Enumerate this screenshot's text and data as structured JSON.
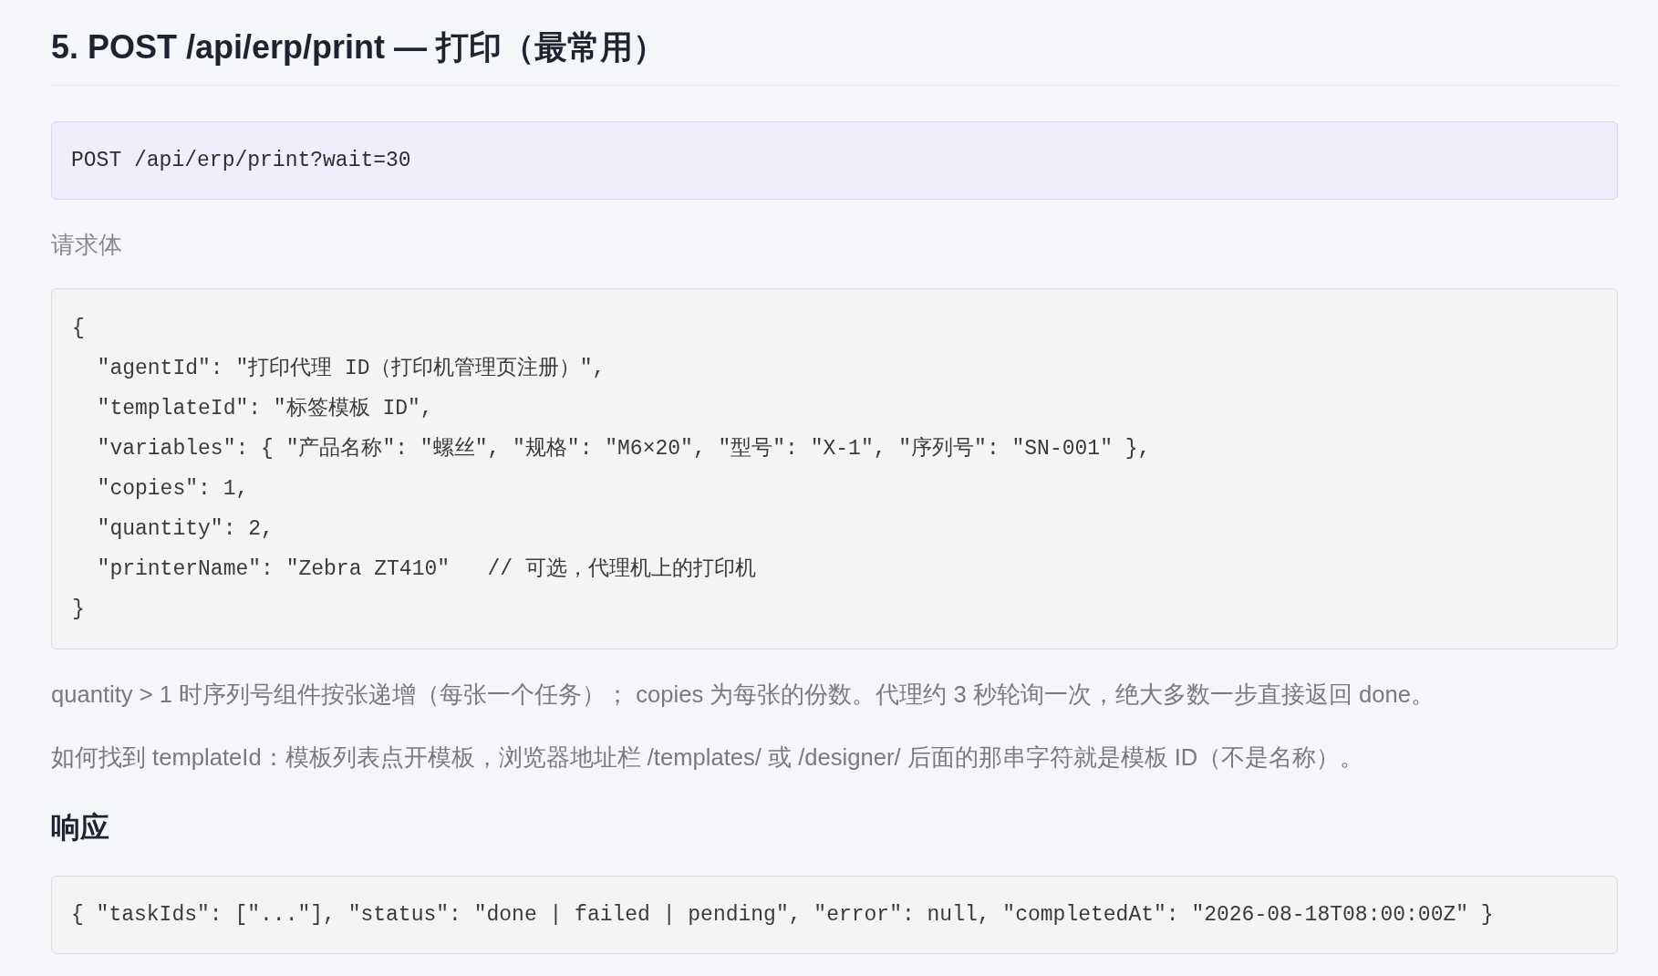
{
  "section": {
    "title": "5. POST /api/erp/print — 打印（最常用）",
    "endpoint": "POST /api/erp/print?wait=30",
    "request_label": "请求体",
    "request_body": [
      "{",
      "  \"agentId\": \"打印代理 ID（打印机管理页注册）\",",
      "  \"templateId\": \"标签模板 ID\",",
      "  \"variables\": { \"产品名称\": \"螺丝\", \"规格\": \"M6×20\", \"型号\": \"X-1\", \"序列号\": \"SN-001\" },",
      "  \"copies\": 1,",
      "  \"quantity\": 2,",
      "  \"printerName\": \"Zebra ZT410\"   // 可选，代理机上的打印机",
      "}"
    ],
    "notes": [
      "quantity > 1 时序列号组件按张递增（每张一个任务）； copies 为每张的份数。代理约 3 秒轮询一次，绝大多数一步直接返回 done。",
      "如何找到 templateId：模板列表点开模板，浏览器地址栏 /templates/ 或 /designer/ 后面的那串字符就是模板 ID（不是名称）。"
    ],
    "response_heading": "响应",
    "response_body": "{ \"taskIds\": [\"...\"], \"status\": \"done | failed | pending\", \"error\": null, \"completedAt\": \"2026-08-18T08:00:00Z\" }"
  }
}
